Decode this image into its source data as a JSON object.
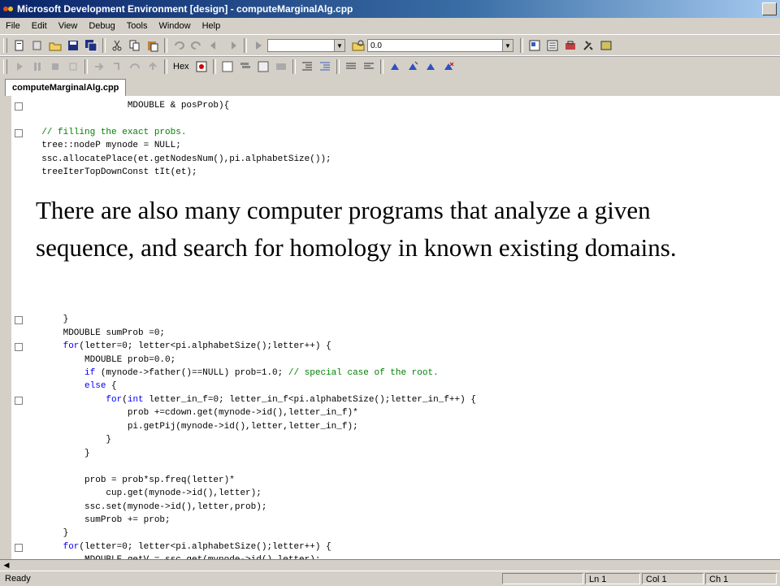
{
  "window": {
    "title": "Microsoft Development Environment [design] - computeMarginalAlg.cpp"
  },
  "menu": [
    "File",
    "Edit",
    "View",
    "Debug",
    "Tools",
    "Window",
    "Help"
  ],
  "toolbar": {
    "config_combo": "",
    "value_combo": "0.0",
    "hex_label": "Hex"
  },
  "tab": {
    "label": "computeMarginalAlg.cpp"
  },
  "code_lines": [
    "                  MDOUBLE & posProb){",
    "",
    "  // filling the exact probs.",
    "  tree::nodeP mynode = NULL;",
    "  ssc.allocatePlace(et.getNodesNum(),pi.alphabetSize());",
    "  treeIterTopDownConst tIt(et);",
    "",
    "",
    "",
    "",
    "",
    "",
    "",
    "",
    "",
    "",
    "      }",
    "      MDOUBLE sumProb =0;",
    "      for(letter=0; letter<pi.alphabetSize();letter++) {",
    "          MDOUBLE prob=0.0;",
    "          if (mynode->father()==NULL) prob=1.0; // special case of the root.",
    "          else {",
    "              for(int letter_in_f=0; letter_in_f<pi.alphabetSize();letter_in_f++) {",
    "                  prob +=cdown.get(mynode->id(),letter_in_f)*",
    "                  pi.getPij(mynode->id(),letter,letter_in_f);",
    "              }",
    "          }",
    "",
    "          prob = prob*sp.freq(letter)*",
    "              cup.get(mynode->id(),letter);",
    "          ssc.set(mynode->id(),letter,prob);",
    "          sumProb += prob;",
    "      }",
    "      for(letter=0; letter<pi.alphabetSize();letter++) {",
    "          MDOUBLE getV = ssc.get(mynode->id(),letter);"
  ],
  "overlay": {
    "text": "There are also many computer programs that analyze a given sequence, and search for homology in known existing domains."
  },
  "status": {
    "ready": "Ready",
    "line": "Ln 1",
    "col": "Col 1",
    "ch": "Ch 1"
  }
}
